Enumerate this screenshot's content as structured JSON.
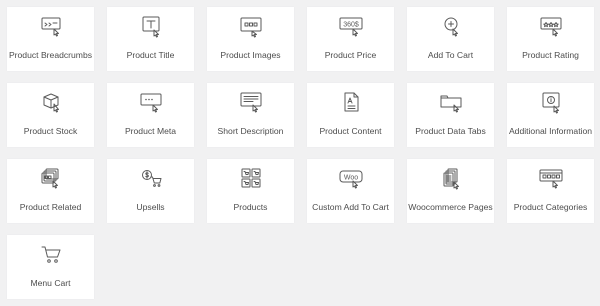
{
  "widgets": [
    {
      "label": "Product Breadcrumbs",
      "icon": "breadcrumbs-icon"
    },
    {
      "label": "Product Title",
      "icon": "title-icon"
    },
    {
      "label": "Product Images",
      "icon": "images-icon"
    },
    {
      "label": "Product Price",
      "icon": "price-icon",
      "icon_text": "360$"
    },
    {
      "label": "Add To Cart",
      "icon": "add-to-cart-icon"
    },
    {
      "label": "Product Rating",
      "icon": "rating-icon"
    },
    {
      "label": "Product Stock",
      "icon": "stock-icon"
    },
    {
      "label": "Product Meta",
      "icon": "meta-icon"
    },
    {
      "label": "Short Description",
      "icon": "short-description-icon"
    },
    {
      "label": "Product Content",
      "icon": "content-icon"
    },
    {
      "label": "Product Data Tabs",
      "icon": "data-tabs-icon"
    },
    {
      "label": "Additional Information",
      "icon": "additional-information-icon"
    },
    {
      "label": "Product Related",
      "icon": "related-icon"
    },
    {
      "label": "Upsells",
      "icon": "upsells-icon"
    },
    {
      "label": "Products",
      "icon": "products-icon"
    },
    {
      "label": "Custom Add To Cart",
      "icon": "custom-add-to-cart-icon",
      "icon_text": "Woo"
    },
    {
      "label": "Woocommerce Pages",
      "icon": "woocommerce-pages-icon"
    },
    {
      "label": "Product Categories",
      "icon": "categories-icon"
    },
    {
      "label": "Menu Cart",
      "icon": "menu-cart-icon"
    }
  ],
  "colors": {
    "background": "#f1f1f2",
    "tile": "#ffffff",
    "icon": "#5a5a5a",
    "label": "#4d4d4d"
  }
}
